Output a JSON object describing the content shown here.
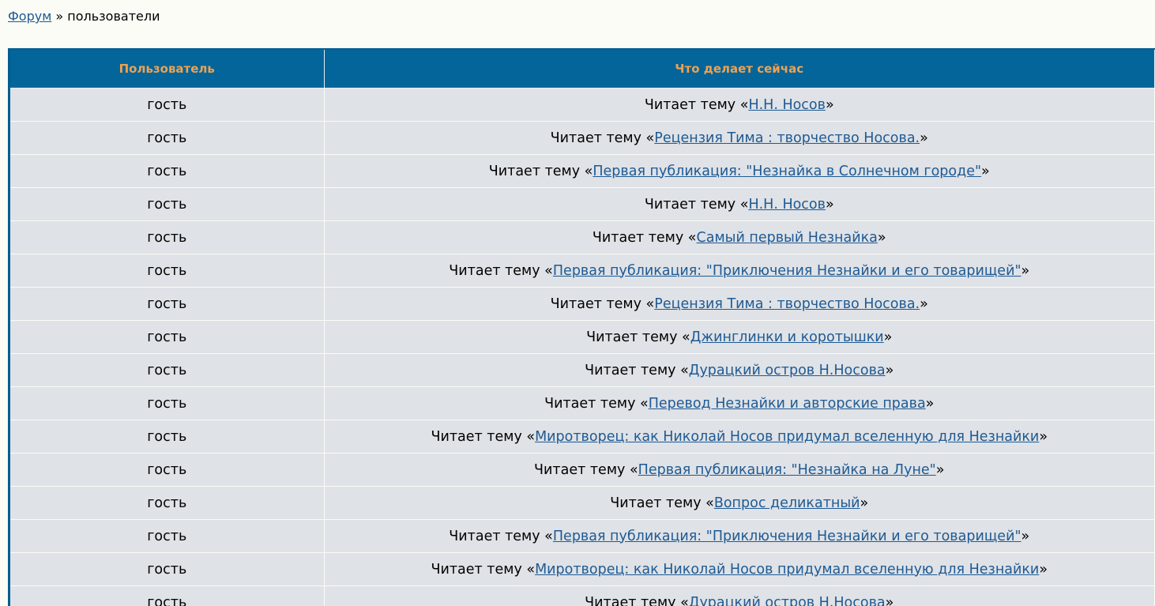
{
  "breadcrumb": {
    "forum_label": "Форум",
    "separator": "»",
    "current": "пользователи"
  },
  "table": {
    "headers": {
      "user": "Пользователь",
      "activity": "Что делает сейчас"
    },
    "rows": [
      {
        "user": "гость",
        "prefix": "Читает тему «",
        "topic": "Н.Н. Носов",
        "suffix": "»"
      },
      {
        "user": "гость",
        "prefix": "Читает тему «",
        "topic": "Рецензия Тима : творчество Носова.",
        "suffix": "»"
      },
      {
        "user": "гость",
        "prefix": "Читает тему «",
        "topic": "Первая публикация: \"Незнайка в Солнечном городе\"",
        "suffix": "»"
      },
      {
        "user": "гость",
        "prefix": "Читает тему «",
        "topic": "Н.Н. Носов",
        "suffix": "»"
      },
      {
        "user": "гость",
        "prefix": "Читает тему «",
        "topic": "Самый первый Незнайка",
        "suffix": "»"
      },
      {
        "user": "гость",
        "prefix": "Читает тему «",
        "topic": "Первая публикация: \"Приключения Незнайки и его товарищей\"",
        "suffix": "»"
      },
      {
        "user": "гость",
        "prefix": "Читает тему «",
        "topic": "Рецензия Тима : творчество Носова.",
        "suffix": "»"
      },
      {
        "user": "гость",
        "prefix": "Читает тему «",
        "topic": "Джинглинки и коротышки",
        "suffix": "»"
      },
      {
        "user": "гость",
        "prefix": "Читает тему «",
        "topic": "Дурацкий остров Н.Носова",
        "suffix": "»"
      },
      {
        "user": "гость",
        "prefix": "Читает тему «",
        "topic": "Перевод Незнайки и авторские права",
        "suffix": "»"
      },
      {
        "user": "гость",
        "prefix": "Читает тему «",
        "topic": "Миротворец: как Николай Носов придумал вселенную для Незнайки",
        "suffix": "»"
      },
      {
        "user": "гость",
        "prefix": "Читает тему «",
        "topic": "Первая публикация: \"Незнайка на Луне\"",
        "suffix": "»"
      },
      {
        "user": "гость",
        "prefix": "Читает тему «",
        "topic": "Вопрос деликатный",
        "suffix": "»"
      },
      {
        "user": "гость",
        "prefix": "Читает тему «",
        "topic": "Первая публикация: \"Приключения Незнайки и его товарищей\"",
        "suffix": "»"
      },
      {
        "user": "гость",
        "prefix": "Читает тему «",
        "topic": "Миротворец: как Николай Носов придумал вселенную для Незнайки",
        "suffix": "»"
      },
      {
        "user": "гость",
        "prefix": "Читает тему «",
        "topic": "Дурацкий остров Н.Носова",
        "suffix": "»"
      }
    ]
  },
  "colors": {
    "header_bg": "#03659a",
    "header_text": "#f0a14f",
    "row_bg": "#dfe2e6",
    "link": "#1e5a94",
    "page_bg": "#fbfcf6"
  }
}
